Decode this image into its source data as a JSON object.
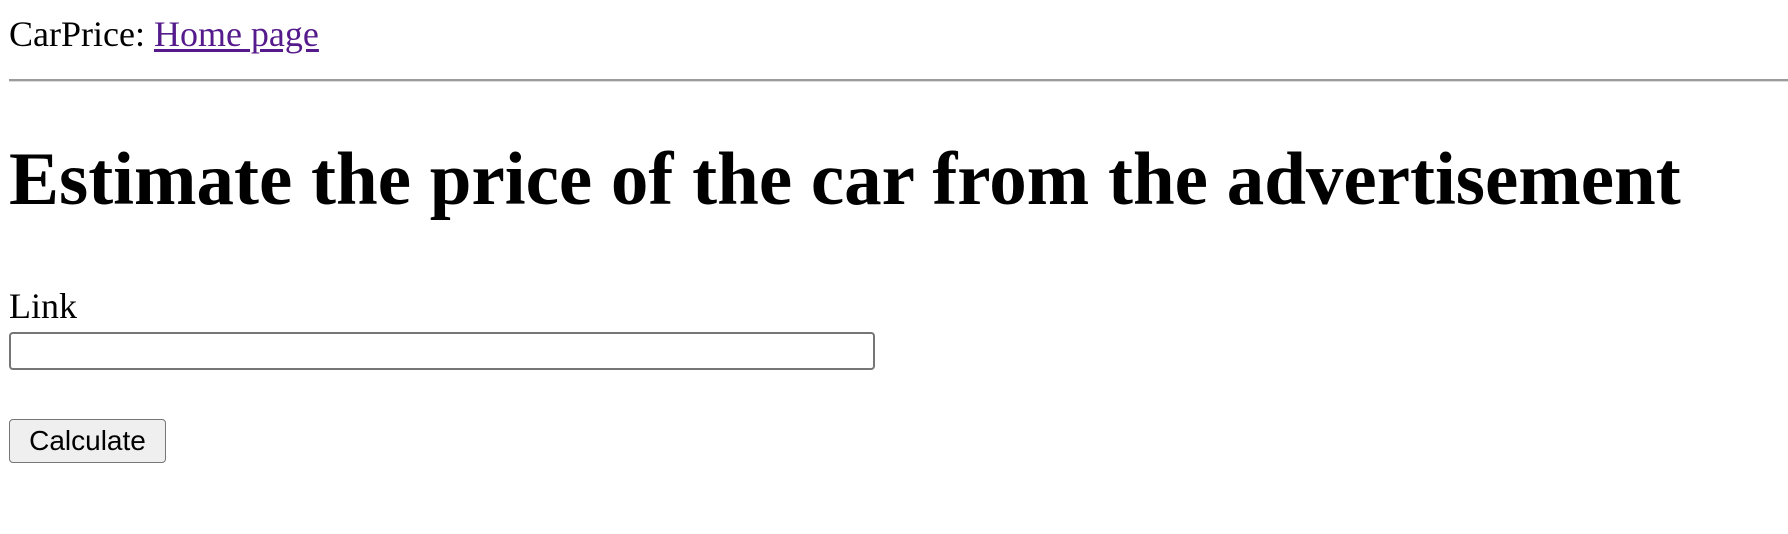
{
  "header": {
    "brand": "CarPrice:",
    "home_link": "Home page"
  },
  "main": {
    "title": "Estimate the price of the car from the advertisement",
    "link_label": "Link",
    "link_value": "",
    "link_placeholder": "",
    "calculate_label": "Calculate"
  },
  "colors": {
    "visited_link": "#551a8b",
    "button_bg": "#efefef",
    "border": "#767676"
  }
}
